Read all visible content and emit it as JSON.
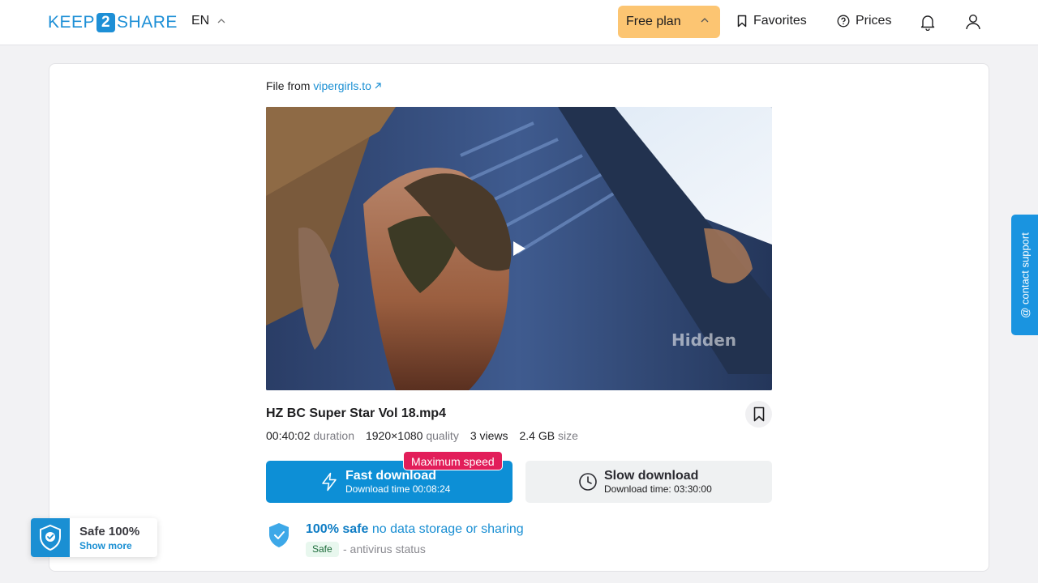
{
  "header": {
    "logo_left": "KEEP",
    "logo_mid": "2",
    "logo_right": "SHARE",
    "language": "EN",
    "plan_label": "Free plan",
    "favorites_label": "Favorites",
    "prices_label": "Prices",
    "icons": [
      "chevron-up-icon",
      "bookmark-icon",
      "help-circle-icon",
      "bell-icon",
      "user-icon"
    ]
  },
  "file": {
    "source_prefix": "File from",
    "source_link": "vipergirls.to",
    "name": "HZ BC Super Star Vol 18.mp4",
    "duration": "00:40:02",
    "duration_label": "duration",
    "quality": "1920×1080",
    "quality_label": "quality",
    "views": "3 views",
    "size": "2.4 GB",
    "size_label": "size",
    "watermark": "Hidden"
  },
  "download": {
    "fast_title": "Fast download",
    "fast_sub": "Download time 00:08:24",
    "badge": "Maximum speed",
    "slow_title": "Slow download",
    "slow_sub": "Download time: 03:30:00"
  },
  "safety": {
    "title_bold": "100% safe",
    "title_rest": " no data storage or sharing",
    "tag": "Safe",
    "desc": "- antivirus status"
  },
  "widgets": {
    "contact": "@ contact support",
    "safe_title": "Safe 100%",
    "safe_link": "Show more"
  },
  "colors": {
    "brand": "#1d8fd6",
    "plan_bg": "#fcc572",
    "fast_bg": "#0d8fd6",
    "badge_bg": "#e21e5a",
    "contact_bg": "#1a94e0"
  }
}
